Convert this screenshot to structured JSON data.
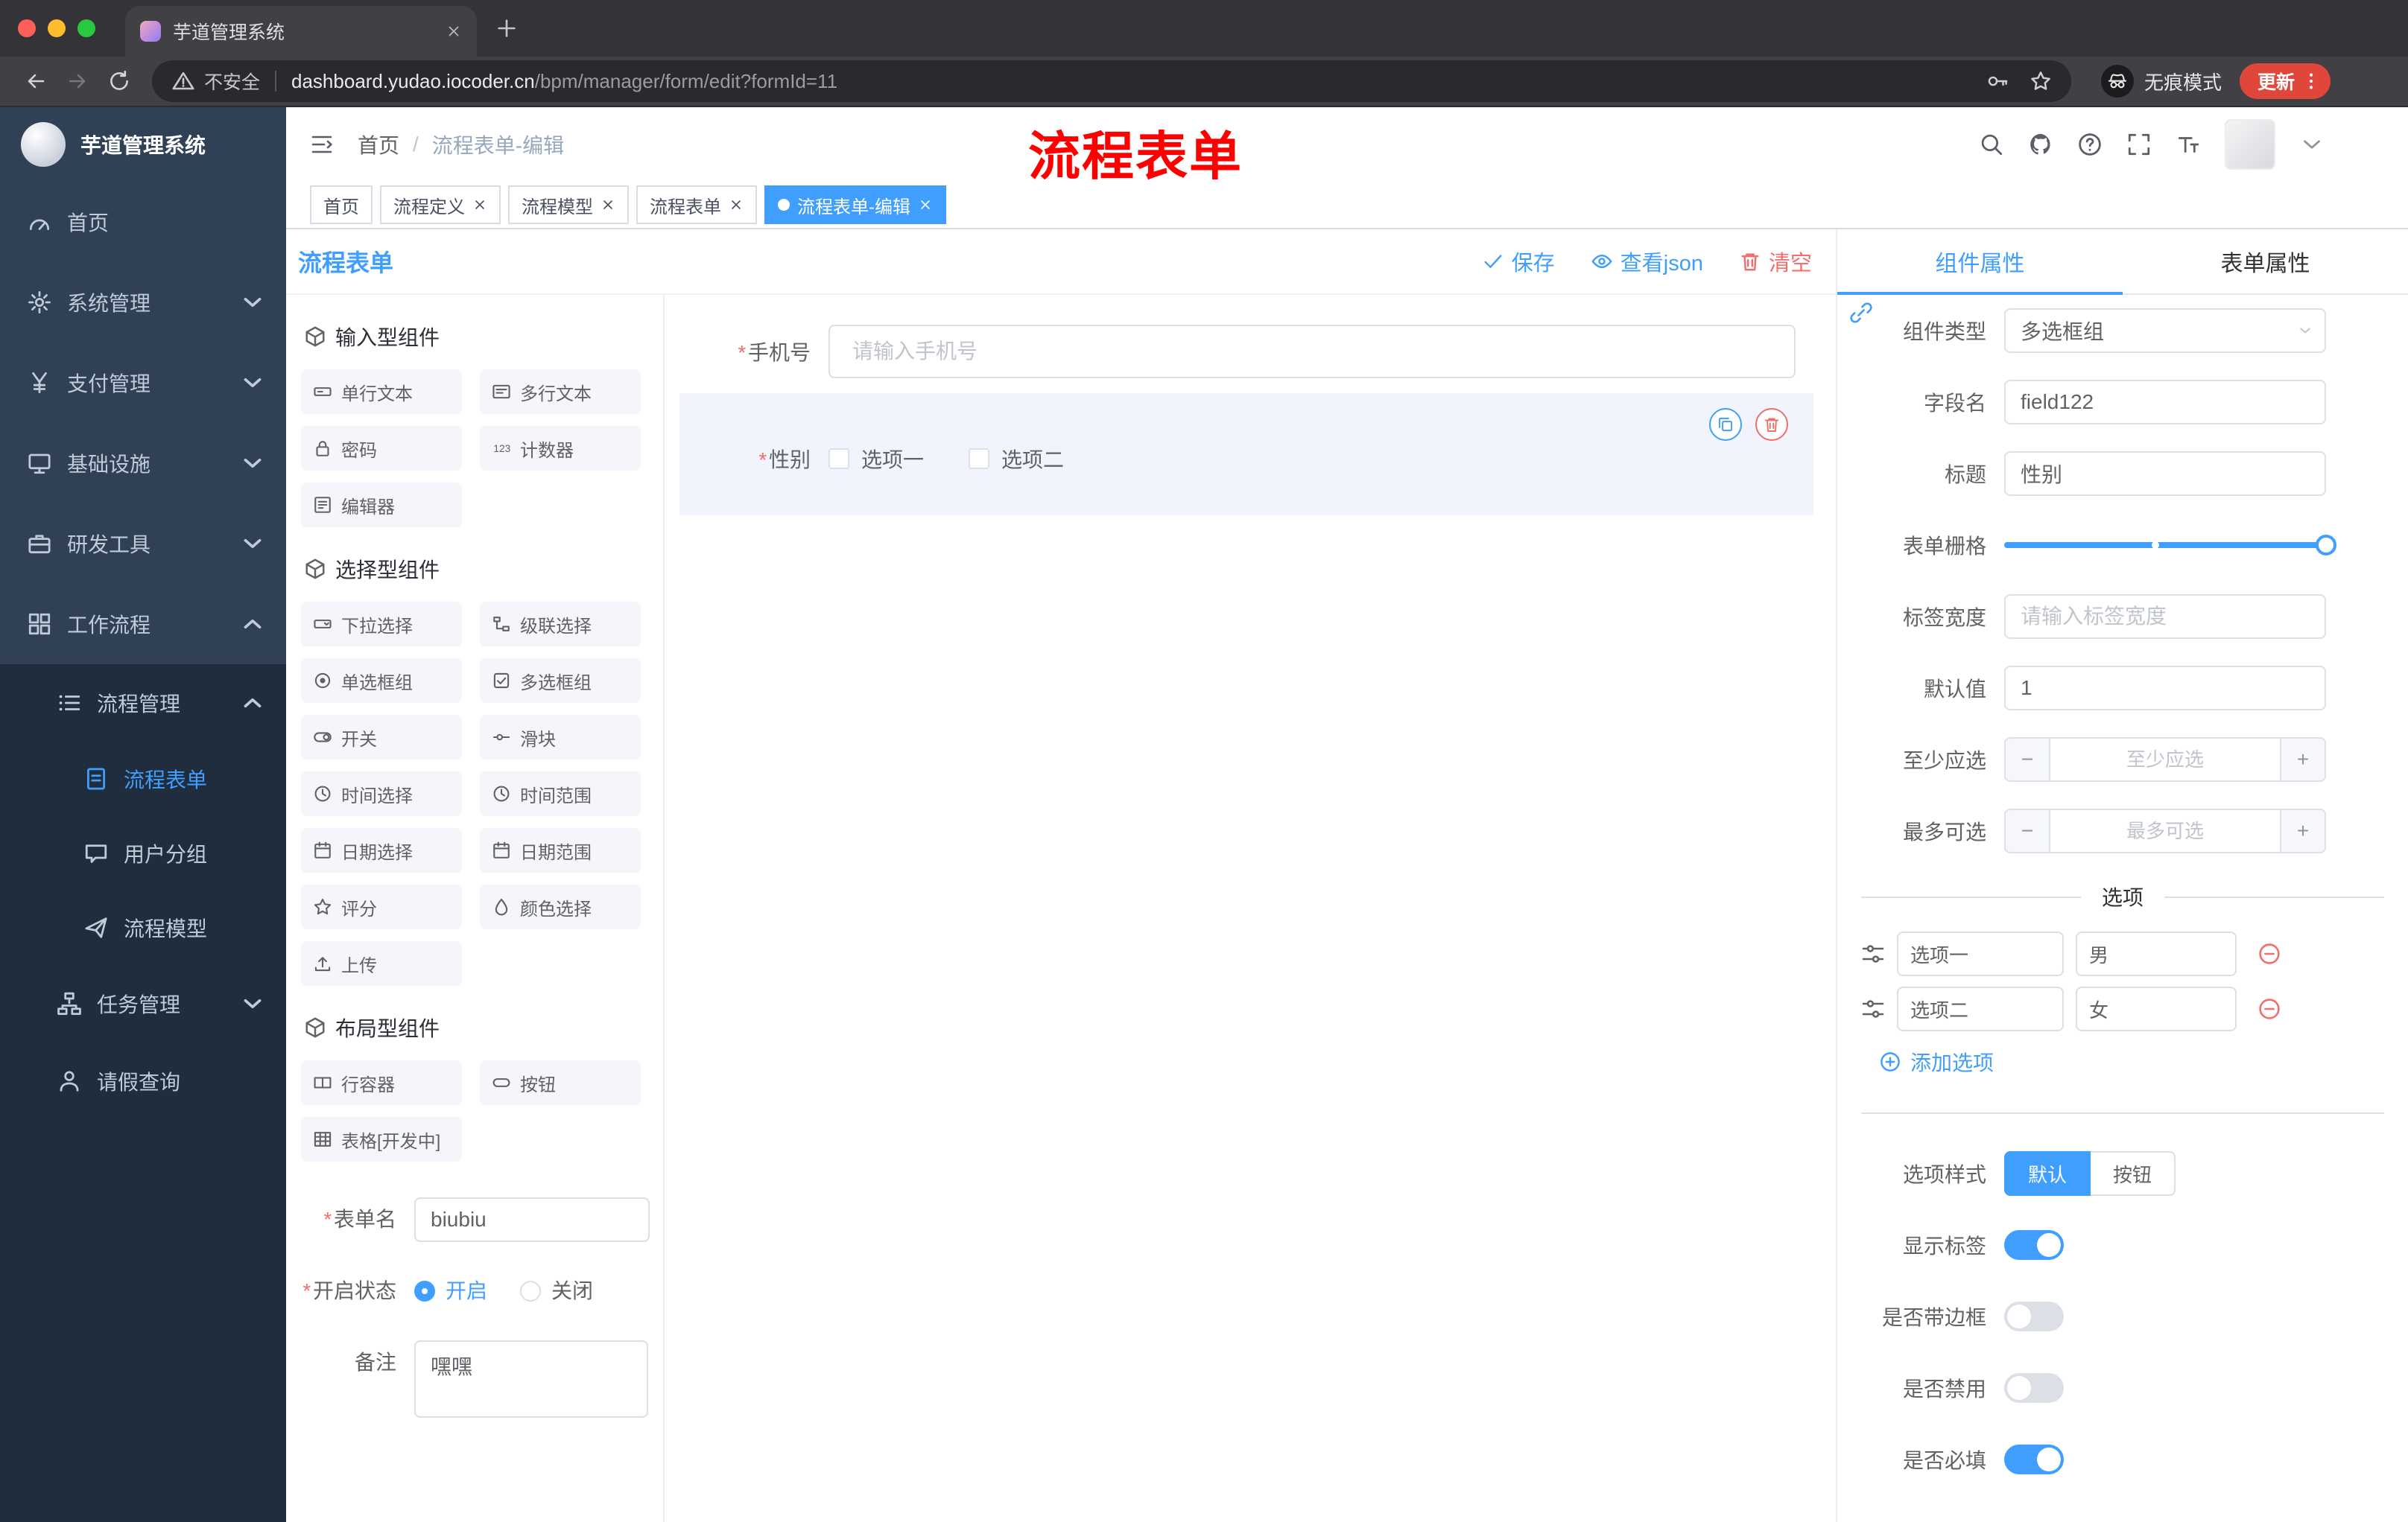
{
  "colors": {
    "accent": "#409eff",
    "danger": "#f56c6c",
    "annotation_red": "#ff0000",
    "sidebar_bg": "#304156",
    "submenu_bg": "#1f2d3d"
  },
  "browser": {
    "tab_title": "芋道管理系统",
    "security_label": "不安全",
    "url_host": "dashboard.yudao.iocoder.cn",
    "url_path": "/bpm/manager/form/edit?formId=11",
    "incognito_label": "无痕模式",
    "update_label": "更新"
  },
  "sidebar": {
    "title": "芋道管理系统",
    "menu": [
      {
        "label": "首页",
        "icon": "dashboard-icon"
      },
      {
        "label": "系统管理",
        "icon": "gear-icon"
      },
      {
        "label": "支付管理",
        "icon": "payment-icon"
      },
      {
        "label": "基础设施",
        "icon": "infrastructure-icon"
      },
      {
        "label": "研发工具",
        "icon": "devtools-icon"
      },
      {
        "label": "工作流程",
        "icon": "workflow-icon"
      },
      {
        "label": "流程管理",
        "icon": "process-manage-icon"
      },
      {
        "label": "流程表单",
        "icon": "process-form-icon"
      },
      {
        "label": "用户分组",
        "icon": "user-group-icon"
      },
      {
        "label": "流程模型",
        "icon": "process-model-icon"
      },
      {
        "label": "任务管理",
        "icon": "task-manage-icon"
      },
      {
        "label": "请假查询",
        "icon": "leave-query-icon"
      }
    ]
  },
  "header": {
    "breadcrumb_root": "首页",
    "breadcrumb_sep": "/",
    "breadcrumb_current": "流程表单-编辑",
    "annotation": "流程表单"
  },
  "tags": [
    {
      "label": "首页"
    },
    {
      "label": "流程定义"
    },
    {
      "label": "流程模型"
    },
    {
      "label": "流程表单"
    },
    {
      "label": "流程表单-编辑"
    }
  ],
  "designer": {
    "title": "流程表单",
    "save_label": "保存",
    "view_json_label": "查看json",
    "clear_label": "清空",
    "group1_title": "输入型组件",
    "group2_title": "选择型组件",
    "group3_title": "布局型组件",
    "group1": [
      {
        "label": "单行文本",
        "icon": "single-line-text-icon"
      },
      {
        "label": "多行文本",
        "icon": "multi-line-text-icon"
      },
      {
        "label": "密码",
        "icon": "password-icon"
      },
      {
        "label": "计数器",
        "icon": "counter-icon"
      },
      {
        "label": "编辑器",
        "icon": "editor-icon"
      }
    ],
    "group2": [
      {
        "label": "下拉选择",
        "icon": "select-icon"
      },
      {
        "label": "级联选择",
        "icon": "cascader-icon"
      },
      {
        "label": "单选框组",
        "icon": "radio-group-icon"
      },
      {
        "label": "多选框组",
        "icon": "checkbox-group-icon"
      },
      {
        "label": "开关",
        "icon": "switch-icon"
      },
      {
        "label": "滑块",
        "icon": "slider-icon"
      },
      {
        "label": "时间选择",
        "icon": "time-picker-icon"
      },
      {
        "label": "时间范围",
        "icon": "time-range-icon"
      },
      {
        "label": "日期选择",
        "icon": "date-picker-icon"
      },
      {
        "label": "日期范围",
        "icon": "date-range-icon"
      },
      {
        "label": "评分",
        "icon": "rate-icon"
      },
      {
        "label": "颜色选择",
        "icon": "color-picker-icon"
      },
      {
        "label": "上传",
        "icon": "upload-icon"
      }
    ],
    "group3": [
      {
        "label": "行容器",
        "icon": "row-container-icon"
      },
      {
        "label": "按钮",
        "icon": "button-icon"
      },
      {
        "label": "表格[开发中]",
        "icon": "table-icon"
      }
    ],
    "form_name_label": "表单名",
    "form_name_value": "biubiu",
    "status_label": "开启状态",
    "status_on": "开启",
    "status_off": "关闭",
    "remark_label": "备注",
    "remark_value": "嘿嘿"
  },
  "canvas": {
    "phone_label": "手机号",
    "phone_placeholder": "请输入手机号",
    "gender_label": "性别",
    "gender_option1": "选项一",
    "gender_option2": "选项二"
  },
  "props": {
    "tab_component": "组件属性",
    "tab_form": "表单属性",
    "component_type_label": "组件类型",
    "component_type_value": "多选框组",
    "field_name_label": "字段名",
    "field_name_value": "field122",
    "title_label": "标题",
    "title_value": "性别",
    "grid_label": "表单栅格",
    "label_width_label": "标签宽度",
    "label_width_placeholder": "请输入标签宽度",
    "default_label": "默认值",
    "default_value": "1",
    "min_label": "至少应选",
    "min_placeholder": "至少应选",
    "max_label": "最多可选",
    "max_placeholder": "最多可选",
    "options_divider": "选项",
    "option1_label": "选项一",
    "option1_value": "男",
    "option2_label": "选项二",
    "option2_value": "女",
    "add_option_label": "添加选项",
    "style_label": "选项样式",
    "style_default": "默认",
    "style_button": "按钮",
    "toggle_show_label": "显示标签",
    "toggle_border": "是否带边框",
    "toggle_disabled": "是否禁用",
    "toggle_required": "是否必填"
  }
}
